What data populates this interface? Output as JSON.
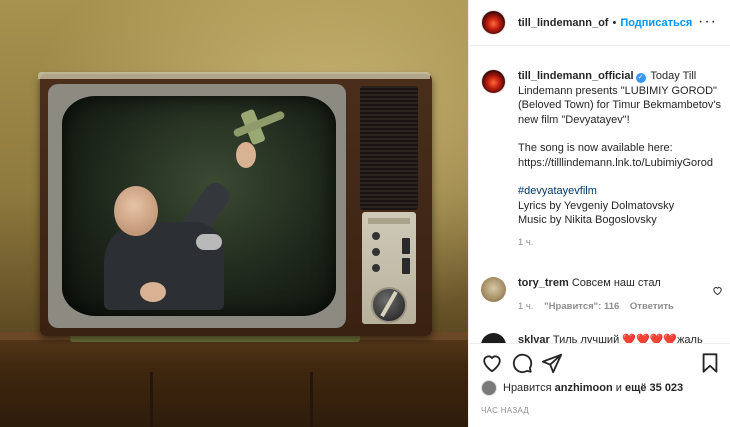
{
  "header": {
    "username": "till_lindemann_of",
    "separator": "•",
    "follow_label": "Подписаться",
    "more_label": "···"
  },
  "caption": {
    "username": "till_lindemann_official",
    "verified_mark": "✓",
    "line1": "Today Till Lindemann presents \"LUBIMIY GOROD\" (Beloved Town) for Timur Bekmambetov's new film \"Devyatayev\"!",
    "line2": "The song is now available here: https://tilllindemann.lnk.to/LubimiyGorod",
    "hashtag": "#devyatayevfilm",
    "line3": "Lyrics by Yevgeniy Dolmatovsky",
    "line4": "Music by Nikita Bogoslovsky",
    "time": "1 ч."
  },
  "comments": [
    {
      "username": "tory_trem",
      "text": "Совсем наш стал",
      "time": "1 ч.",
      "likes": "\"Нравится\": 116",
      "reply": "Ответить"
    },
    {
      "username": "sklyar",
      "text": "Тиль лучший ❤️❤️❤️❤️жаль"
    }
  ],
  "actions": {
    "likes_prefix": "Нравится",
    "likes_user": "anzhimoon",
    "likes_middle": "и",
    "likes_count": "ещё 35 023",
    "time_ago": "ЧАС НАЗАД"
  },
  "icons": {
    "like": "heart-icon",
    "comment": "comment-icon",
    "share": "share-icon",
    "save": "bookmark-icon",
    "comment_like": "heart-icon"
  },
  "colors": {
    "link": "#0095f6",
    "hashtag": "#00376b",
    "muted": "#8e8e8e"
  }
}
